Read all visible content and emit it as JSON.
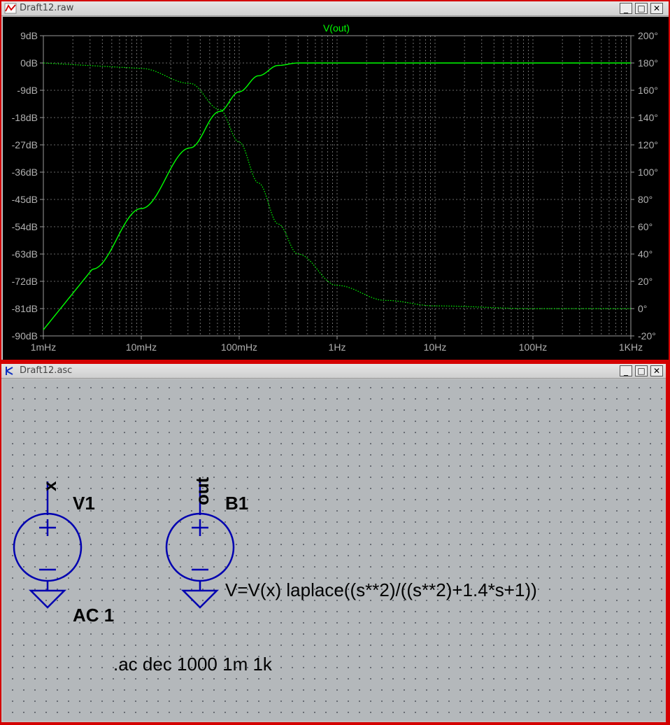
{
  "raw_window": {
    "title": "Draft12.raw",
    "buttons": {
      "minimize": "_",
      "maximize": "□",
      "close": "✕"
    },
    "trace_label": "V(out)",
    "trace_color": "#00ff00"
  },
  "chart_data": {
    "type": "line",
    "title": "V(out)",
    "x_scale": "log",
    "xlim": [
      0.001,
      1000
    ],
    "x_ticks": [
      "1mHz",
      "10mHz",
      "100mHz",
      "1Hz",
      "10Hz",
      "100Hz",
      "1KHz"
    ],
    "y_left_ticks": [
      "9dB",
      "0dB",
      "-9dB",
      "-18dB",
      "-27dB",
      "-36dB",
      "-45dB",
      "-54dB",
      "-63dB",
      "-72dB",
      "-81dB",
      "-90dB"
    ],
    "y_left_lim": [
      -90,
      9
    ],
    "y_right_ticks": [
      "200°",
      "180°",
      "160°",
      "140°",
      "120°",
      "100°",
      "80°",
      "60°",
      "40°",
      "20°",
      "0°",
      "-20°"
    ],
    "y_right_lim": [
      -20,
      200
    ],
    "grid": true,
    "series": [
      {
        "quantity": "magnitude",
        "axis": "left",
        "style": "solid",
        "x": [
          0.001,
          0.00316,
          0.01,
          0.0316,
          0.0631,
          0.1,
          0.158,
          0.251,
          0.398,
          1,
          1000
        ],
        "values": [
          -88,
          -68,
          -48,
          -28,
          -16,
          -9.5,
          -4.2,
          -0.8,
          0,
          0,
          0
        ]
      },
      {
        "quantity": "phase",
        "axis": "right",
        "style": "dotted",
        "x": [
          0.001,
          0.01,
          0.0316,
          0.0631,
          0.1,
          0.158,
          0.251,
          0.398,
          1,
          3.16,
          10,
          100,
          1000
        ],
        "values": [
          180,
          176,
          165,
          146,
          122,
          92,
          62,
          40,
          17,
          6,
          2,
          0,
          0
        ]
      }
    ]
  },
  "asc_window": {
    "title": "Draft12.asc",
    "buttons": {
      "minimize": "_",
      "maximize": "□",
      "close": "✕"
    },
    "components": {
      "v1": {
        "name": "V1",
        "node": "x",
        "value": "AC 1",
        "plus": "+",
        "minus": "–"
      },
      "b1": {
        "name": "B1",
        "node": "out",
        "value": "V=V(x) laplace((s**2)/((s**2)+1.4*s+1))",
        "plus": "+",
        "minus": "–"
      }
    },
    "directive": ".ac dec 1000 1m 1k",
    "wire_color": "#0000b0"
  }
}
